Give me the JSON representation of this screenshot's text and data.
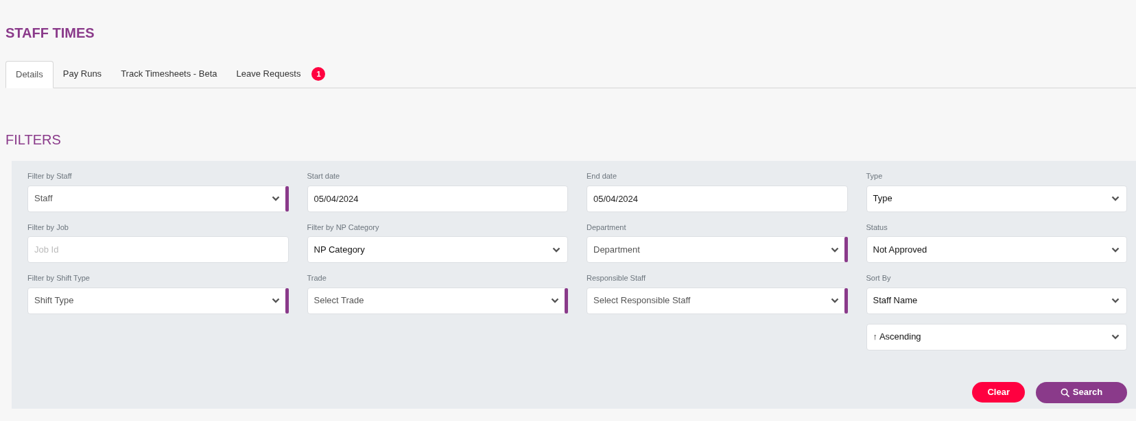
{
  "page": {
    "title": "STAFF TIMES"
  },
  "tabs": [
    {
      "label": "Details",
      "selected": true
    },
    {
      "label": "Pay Runs",
      "selected": false
    },
    {
      "label": "Track Timesheets - Beta",
      "selected": false
    },
    {
      "label": "Leave Requests",
      "selected": false,
      "badge": "1"
    }
  ],
  "filters": {
    "heading": "FILTERS",
    "columns": [
      [
        {
          "kind": "select",
          "label": "Filter by Staff",
          "placeholder": "Staff",
          "marked": true
        },
        {
          "kind": "input",
          "label": "Filter by Job",
          "placeholder": "Job Id",
          "marked": false
        },
        {
          "kind": "select",
          "label": "Filter by Shift Type",
          "placeholder": "Shift Type",
          "marked": true
        }
      ],
      [
        {
          "kind": "input",
          "label": "Start date",
          "value": "05/04/2024",
          "marked": false
        },
        {
          "kind": "select",
          "label": "Filter by NP Category",
          "value": "NP Category",
          "marked": false
        },
        {
          "kind": "select",
          "label": "Trade",
          "placeholder": "Select Trade",
          "marked": true
        }
      ],
      [
        {
          "kind": "input",
          "label": "End date",
          "value": "05/04/2024",
          "marked": false
        },
        {
          "kind": "select",
          "label": "Department",
          "placeholder": "Department",
          "marked": true
        },
        {
          "kind": "select",
          "label": "Responsible Staff",
          "placeholder": "Select Responsible Staff",
          "marked": true
        }
      ],
      [
        {
          "kind": "select",
          "label": "Type",
          "value": "Type",
          "marked": false
        },
        {
          "kind": "select",
          "label": "Status",
          "value": "Not Approved",
          "marked": false
        },
        {
          "kind": "select",
          "label": "Sort By",
          "value": "Staff Name",
          "marked": false
        },
        {
          "kind": "select",
          "value": "↑ Ascending",
          "marked": false
        }
      ]
    ],
    "buttons": [
      {
        "kind": "clear",
        "label": "Clear"
      },
      {
        "kind": "search",
        "label": "Search"
      }
    ]
  }
}
